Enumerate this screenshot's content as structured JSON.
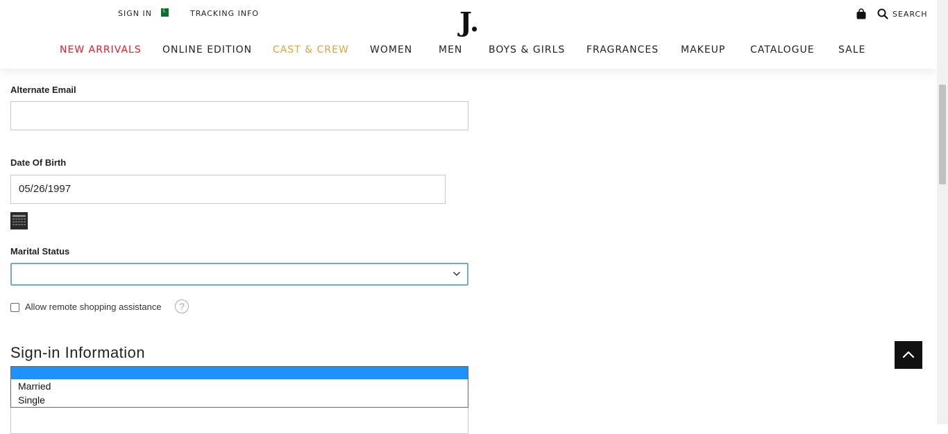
{
  "header": {
    "sign_in": "SIGN IN",
    "tracking": "TRACKING INFO",
    "logo": "J.",
    "search_label": "SEARCH",
    "nav": [
      {
        "label": "NEW ARRIVALS",
        "color": "#e31e24"
      },
      {
        "label": "ONLINE EDITION",
        "color": "#222222"
      },
      {
        "label": "CAST & CREW",
        "color": "#d9a441"
      },
      {
        "label": "WOMEN",
        "color": "#222222"
      },
      {
        "label": "MEN",
        "color": "#222222"
      },
      {
        "label": "BOYS & GIRLS",
        "color": "#222222"
      },
      {
        "label": "FRAGRANCES",
        "color": "#222222"
      },
      {
        "label": "MAKEUP",
        "color": "#222222"
      },
      {
        "label": "CATALOGUE",
        "color": "#222222"
      },
      {
        "label": "SALE",
        "color": "#222222"
      }
    ]
  },
  "form": {
    "alt_email_label": "Alternate Email",
    "alt_email_value": "",
    "dob_label": "Date Of Birth",
    "dob_value": "05/26/1997",
    "marital_label": "Marital Status",
    "marital_value": "",
    "remote_label": "Allow remote shopping assistance",
    "remote_checked": false,
    "signin_section_title": "Sign-in Information"
  },
  "marital_options": [
    "",
    "Married",
    "Single"
  ],
  "icons": {
    "flag": "pakistan-flag-icon",
    "bag": "shopping-bag-icon",
    "search": "search-icon",
    "calendar": "calendar-icon",
    "help": "help-icon",
    "back_to_top": "arrow-up-icon"
  }
}
